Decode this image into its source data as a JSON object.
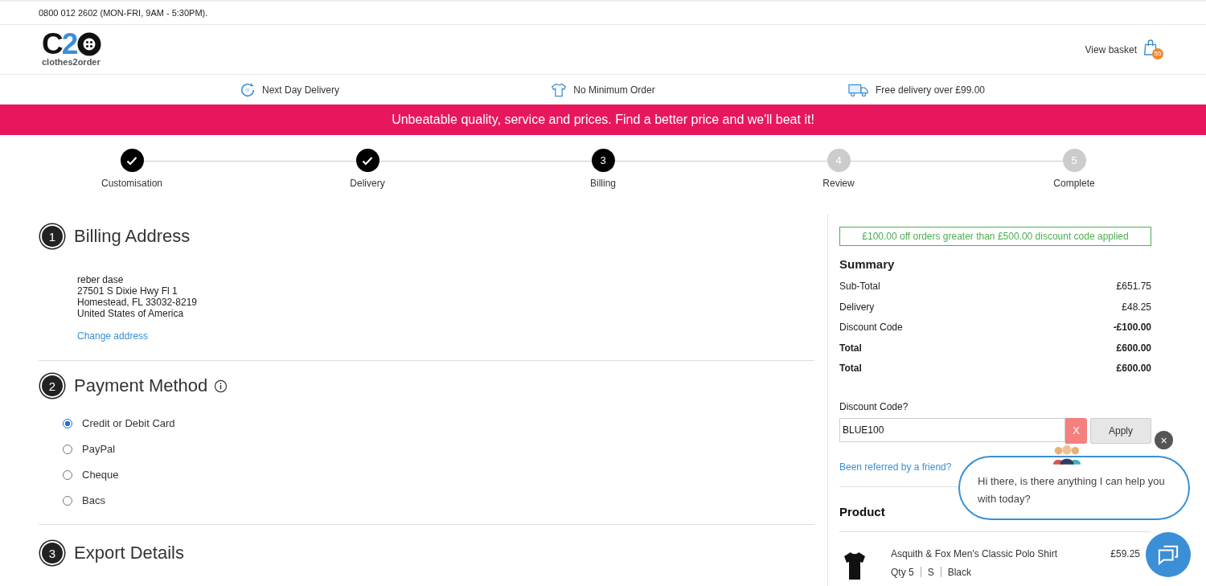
{
  "topbar": {
    "phone": "0800 012 2602 (MON-FRI, 9AM - 5:30PM)."
  },
  "header": {
    "logo": {
      "letters": [
        {
          "text": "C",
          "color": "#111111"
        },
        {
          "text": "2",
          "color": "#3a8fd6"
        }
      ],
      "tagline": "clothes2order"
    },
    "basket": {
      "label": "View basket",
      "count": "55"
    }
  },
  "usps": [
    {
      "kind": "clock",
      "label": "Next Day Delivery"
    },
    {
      "kind": "shirt",
      "label": "No Minimum Order"
    },
    {
      "kind": "van",
      "label": "Free delivery over £99.00"
    }
  ],
  "banner": "Unbeatable quality, service and prices. Find a better price and we'll beat it!",
  "steps": [
    {
      "label": "Customisation",
      "kind": "done"
    },
    {
      "label": "Delivery",
      "kind": "done"
    },
    {
      "number": "3",
      "label": "Billing",
      "kind": "current"
    },
    {
      "number": "4",
      "label": "Review",
      "kind": "todo"
    },
    {
      "number": "5",
      "label": "Complete",
      "kind": "todo"
    }
  ],
  "billing": {
    "number": "1",
    "title": "Billing Address",
    "address": [
      "reber dase",
      "27501 S Dixie Hwy Fl 1",
      "Homestead, FL 33032-8219",
      "United States of America"
    ],
    "change_link": "Change address"
  },
  "payment": {
    "number": "2",
    "title": "Payment Method",
    "options": [
      {
        "label": "Credit or Debit Card",
        "selected": true
      },
      {
        "label": "PayPal",
        "selected": false
      },
      {
        "label": "Cheque",
        "selected": false
      },
      {
        "label": "Bacs",
        "selected": false
      }
    ]
  },
  "export": {
    "number": "3",
    "title": "Export Details"
  },
  "summary": {
    "notice": "£100.00 off orders greater than £500.00 discount code applied",
    "title": "Summary",
    "rows": [
      {
        "kind": "line",
        "label": "Sub-Total",
        "value": "£651.75"
      },
      {
        "kind": "line",
        "label": "Delivery",
        "value": "£48.25"
      },
      {
        "kind": "discount",
        "label": "Discount Code",
        "value": "-£100.00"
      },
      {
        "kind": "total",
        "label": "Total",
        "value": "£600.00"
      },
      {
        "kind": "total",
        "label": "Total",
        "value": "£600.00"
      }
    ],
    "discount": {
      "label": "Discount Code?",
      "value": "BLUE100",
      "clear": "X",
      "apply": "Apply"
    },
    "referral_link": "Been referred by a friend?",
    "product_heading": "Product",
    "products": [
      {
        "name": "Asquith & Fox Men's Classic Polo Shirt",
        "price": "£59.25",
        "details": [
          "Qty 5",
          "S",
          "Black"
        ]
      }
    ]
  },
  "chat": {
    "close": "×",
    "message": "Hi there, is there anything I can help you with today?"
  }
}
